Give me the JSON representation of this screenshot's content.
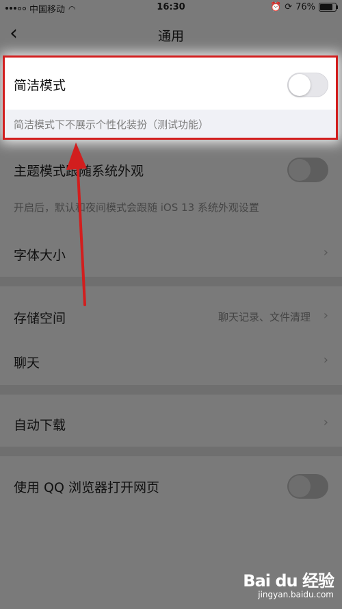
{
  "status_bar": {
    "carrier": "中国移动",
    "time": "16:30",
    "battery": "76%"
  },
  "nav": {
    "back_icon": "chevron-left-icon",
    "title": "通用"
  },
  "settings": {
    "concise_mode": {
      "label": "简洁模式",
      "enabled": false,
      "description": "简洁模式下不展示个性化装扮（测试功能）"
    },
    "theme_follow_system": {
      "label": "主题模式跟随系统外观",
      "enabled": false,
      "description": "开启后，默认和夜间模式会跟随 iOS 13 系统外观设置"
    },
    "font_size": {
      "label": "字体大小"
    },
    "storage": {
      "label": "存储空间",
      "value": "聊天记录、文件清理"
    },
    "chat": {
      "label": "聊天"
    },
    "auto_download": {
      "label": "自动下载"
    },
    "qq_browser": {
      "label": "使用 QQ 浏览器打开网页",
      "enabled": false
    }
  },
  "colors": {
    "highlight_frame": "#d21e1e",
    "arrow": "#d21e1e",
    "dim_overlay": "#7a7a7a"
  },
  "watermark": {
    "brand": "Bai du 经验",
    "site": "jingyan.baidu.com"
  }
}
